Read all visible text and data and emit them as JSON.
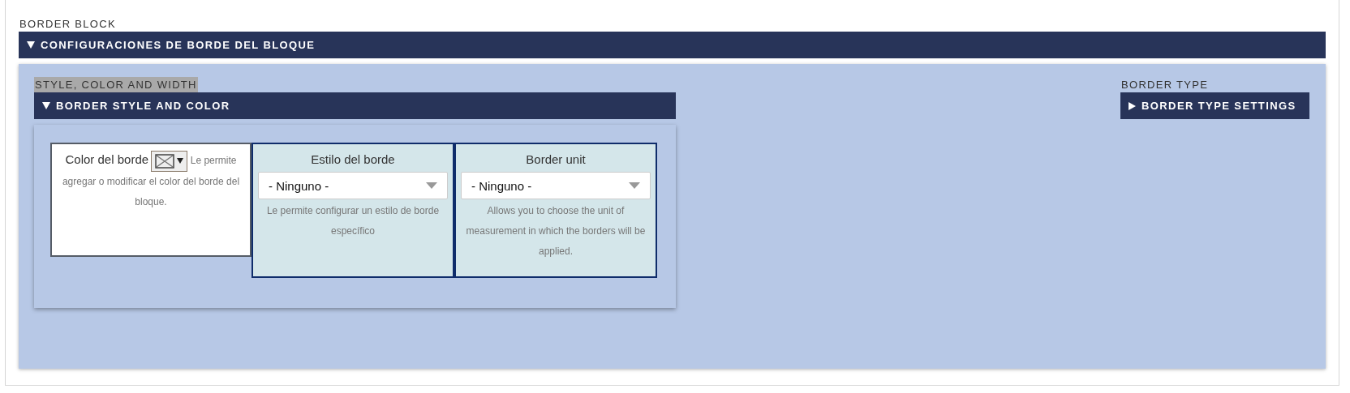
{
  "section": {
    "label": "BORDER BLOCK",
    "header": {
      "title": "CONFIGURACIONES DE BORDE DEL BLOQUE",
      "expanded": true
    }
  },
  "left_group": {
    "label": "STYLE, COLOR AND WIDTH",
    "highlighted": true,
    "header": {
      "title": "BORDER STYLE AND COLOR",
      "expanded": true
    },
    "fields": [
      {
        "kind": "color",
        "label": "Color del borde",
        "help": "Le permite agregar o modificar el color del borde del bloque.",
        "selected": false
      },
      {
        "kind": "select",
        "label": "Estilo del borde",
        "value": "- Ninguno -",
        "help": "Le permite configurar un estilo de borde específico",
        "selected": true
      },
      {
        "kind": "select",
        "label": "Border unit",
        "value": "- Ninguno -",
        "help": "Allows you to choose the unit of measurement in which the borders will be applied.",
        "selected": true
      }
    ]
  },
  "right_group": {
    "label": "BORDER TYPE",
    "header": {
      "title": "BORDER TYPE SETTINGS",
      "expanded": false
    }
  }
}
